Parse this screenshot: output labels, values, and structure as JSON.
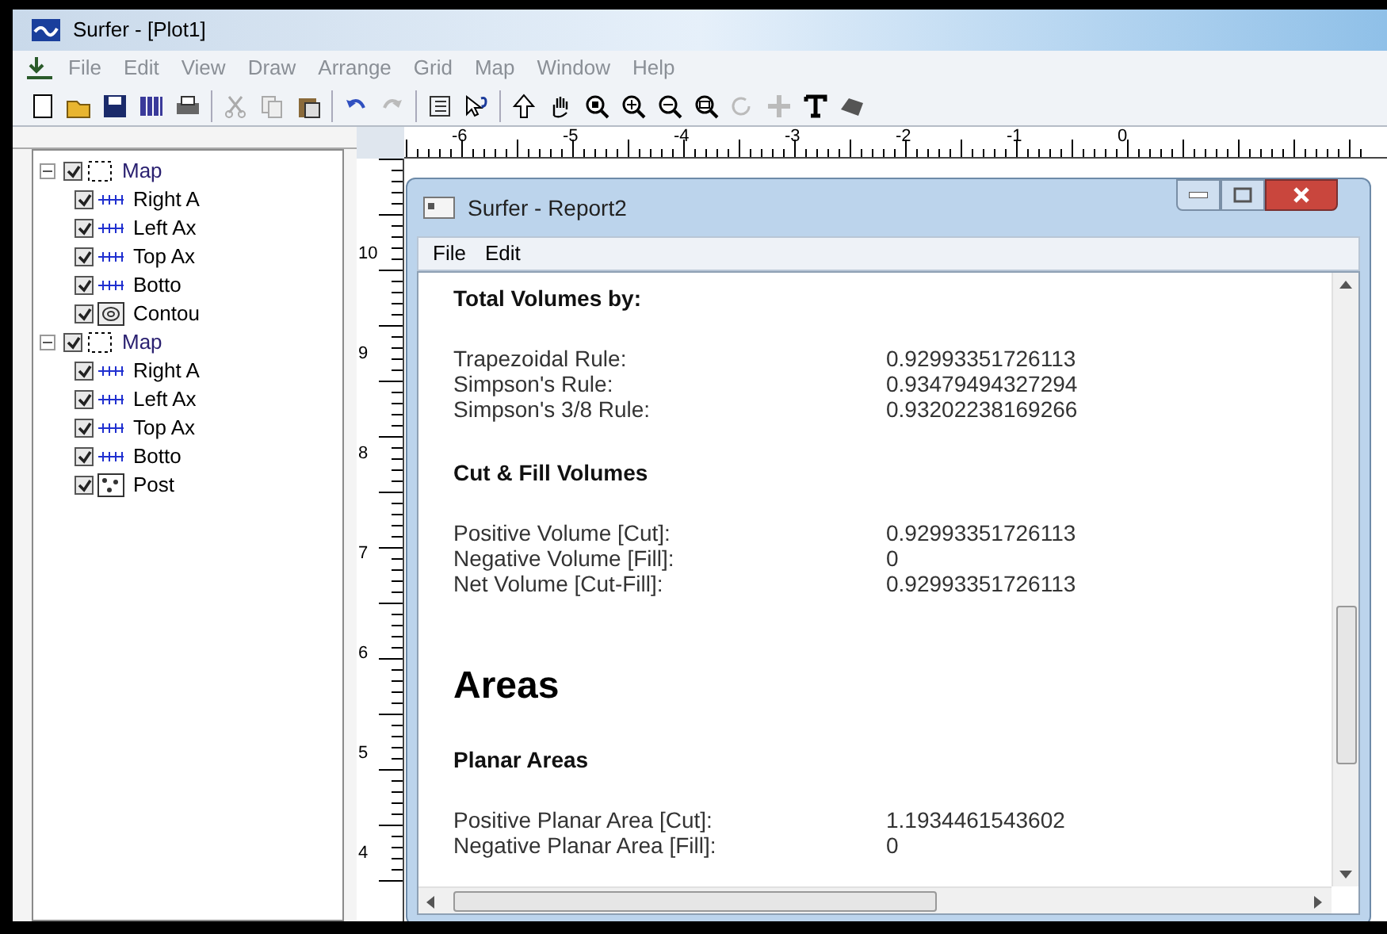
{
  "main_window": {
    "title": "Surfer - [Plot1]"
  },
  "menu": [
    "File",
    "Edit",
    "View",
    "Draw",
    "Arrange",
    "Grid",
    "Map",
    "Window",
    "Help"
  ],
  "top_ruler": [
    "-6",
    "-5",
    "-4",
    "-3",
    "-2",
    "-1",
    "0"
  ],
  "side_ruler": [
    "10",
    "9",
    "8",
    "7",
    "6",
    "5",
    "4"
  ],
  "tree": [
    {
      "label": "Map",
      "kind": "map",
      "checked": true,
      "expanded": true,
      "children": [
        {
          "label": "Right A",
          "kind": "axis",
          "checked": true
        },
        {
          "label": "Left Ax",
          "kind": "axis",
          "checked": true
        },
        {
          "label": "Top Ax",
          "kind": "axis",
          "checked": true
        },
        {
          "label": "Botto",
          "kind": "axis",
          "checked": true
        },
        {
          "label": "Contou",
          "kind": "contour",
          "checked": true
        }
      ]
    },
    {
      "label": "Map",
      "kind": "map",
      "checked": true,
      "expanded": true,
      "children": [
        {
          "label": "Right A",
          "kind": "axis",
          "checked": true
        },
        {
          "label": "Left Ax",
          "kind": "axis",
          "checked": true
        },
        {
          "label": "Top Ax",
          "kind": "axis",
          "checked": true
        },
        {
          "label": "Botto",
          "kind": "axis",
          "checked": true
        },
        {
          "label": "Post",
          "kind": "post",
          "checked": true
        }
      ]
    }
  ],
  "report_window": {
    "title": "Surfer - Report2",
    "menu": [
      "File",
      "Edit"
    ],
    "lines": [
      {
        "kind": "heading",
        "text": "Total Volumes by:"
      },
      {
        "kind": "row",
        "label": "Trapezoidal Rule:",
        "value": "0.92993351726113"
      },
      {
        "kind": "row",
        "label": "Simpson's Rule:",
        "value": "0.93479494327294"
      },
      {
        "kind": "row",
        "label": "Simpson's 3/8 Rule:",
        "value": "0.93202238169266"
      },
      {
        "kind": "heading",
        "text": "Cut & Fill Volumes"
      },
      {
        "kind": "row",
        "label": "Positive Volume [Cut]:",
        "value": "0.92993351726113"
      },
      {
        "kind": "row",
        "label": "Negative Volume [Fill]:",
        "value": "0"
      },
      {
        "kind": "row",
        "label": "Net Volume [Cut-Fill]:",
        "value": "0.92993351726113"
      },
      {
        "kind": "title",
        "text": "Areas"
      },
      {
        "kind": "heading",
        "text": "Planar Areas"
      },
      {
        "kind": "row",
        "label": "Positive Planar Area [Cut]:",
        "value": "1.1934461543602"
      },
      {
        "kind": "row",
        "label": "Negative Planar Area [Fill]:",
        "value": "0"
      }
    ]
  }
}
